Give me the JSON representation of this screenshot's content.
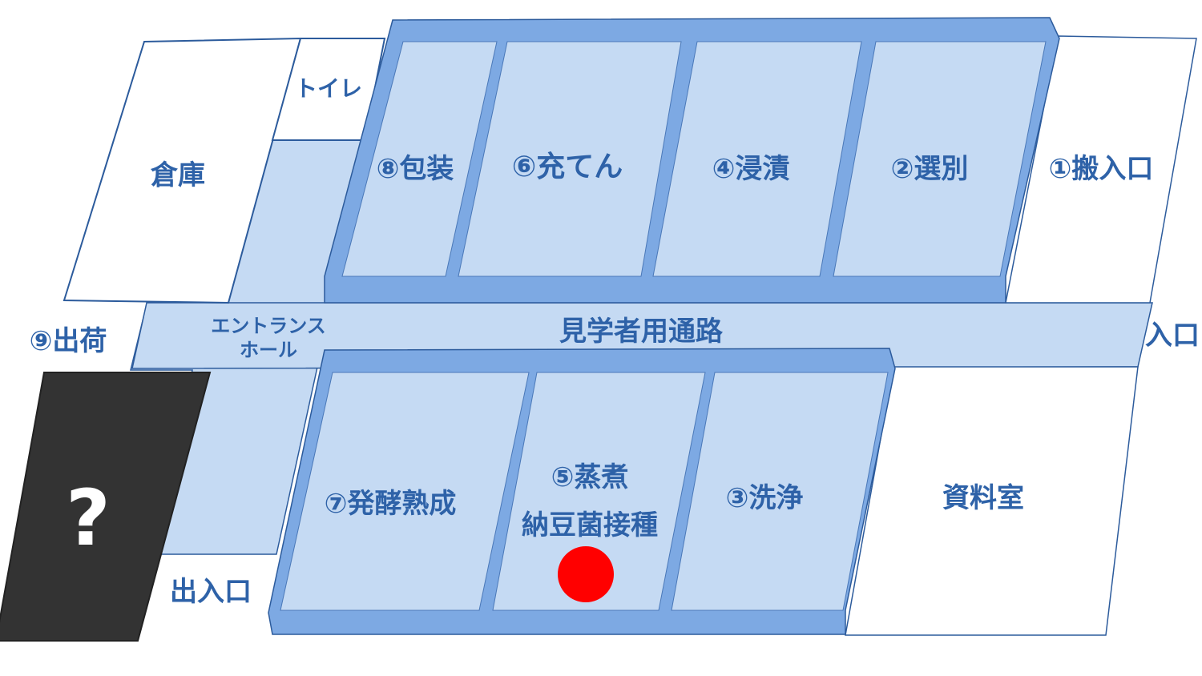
{
  "floor_map": {
    "rooms": {
      "warehouse": "倉庫",
      "toilet": "トイレ",
      "receiving": "①搬入口",
      "sorting": "②選別",
      "washing": "③洗浄",
      "soaking": "④浸漬",
      "steaming_label_1": "⑤蒸煮",
      "steaming_label_2": "納豆菌接種",
      "filling": "⑥充てん",
      "fermentation": "⑦発酵熟成",
      "packaging": "⑧包装",
      "shipping": "⑨出荷",
      "archive": "資料室",
      "entrance_hall_1": "エントランス",
      "entrance_hall_2": "ホール",
      "visitor_passage": "見学者用通路",
      "entrance_right": "入口",
      "entrance_exit": "出入口",
      "mystery": "?"
    },
    "current_location_marker": "⑤蒸煮 納豆菌接種",
    "colors": {
      "label": "#2e62a8",
      "corridor": "#c5daf3",
      "wall": "#7da9e3",
      "outline": "#2c5b9c",
      "marker": "#ff0000",
      "mystery_fill": "#333333"
    }
  }
}
